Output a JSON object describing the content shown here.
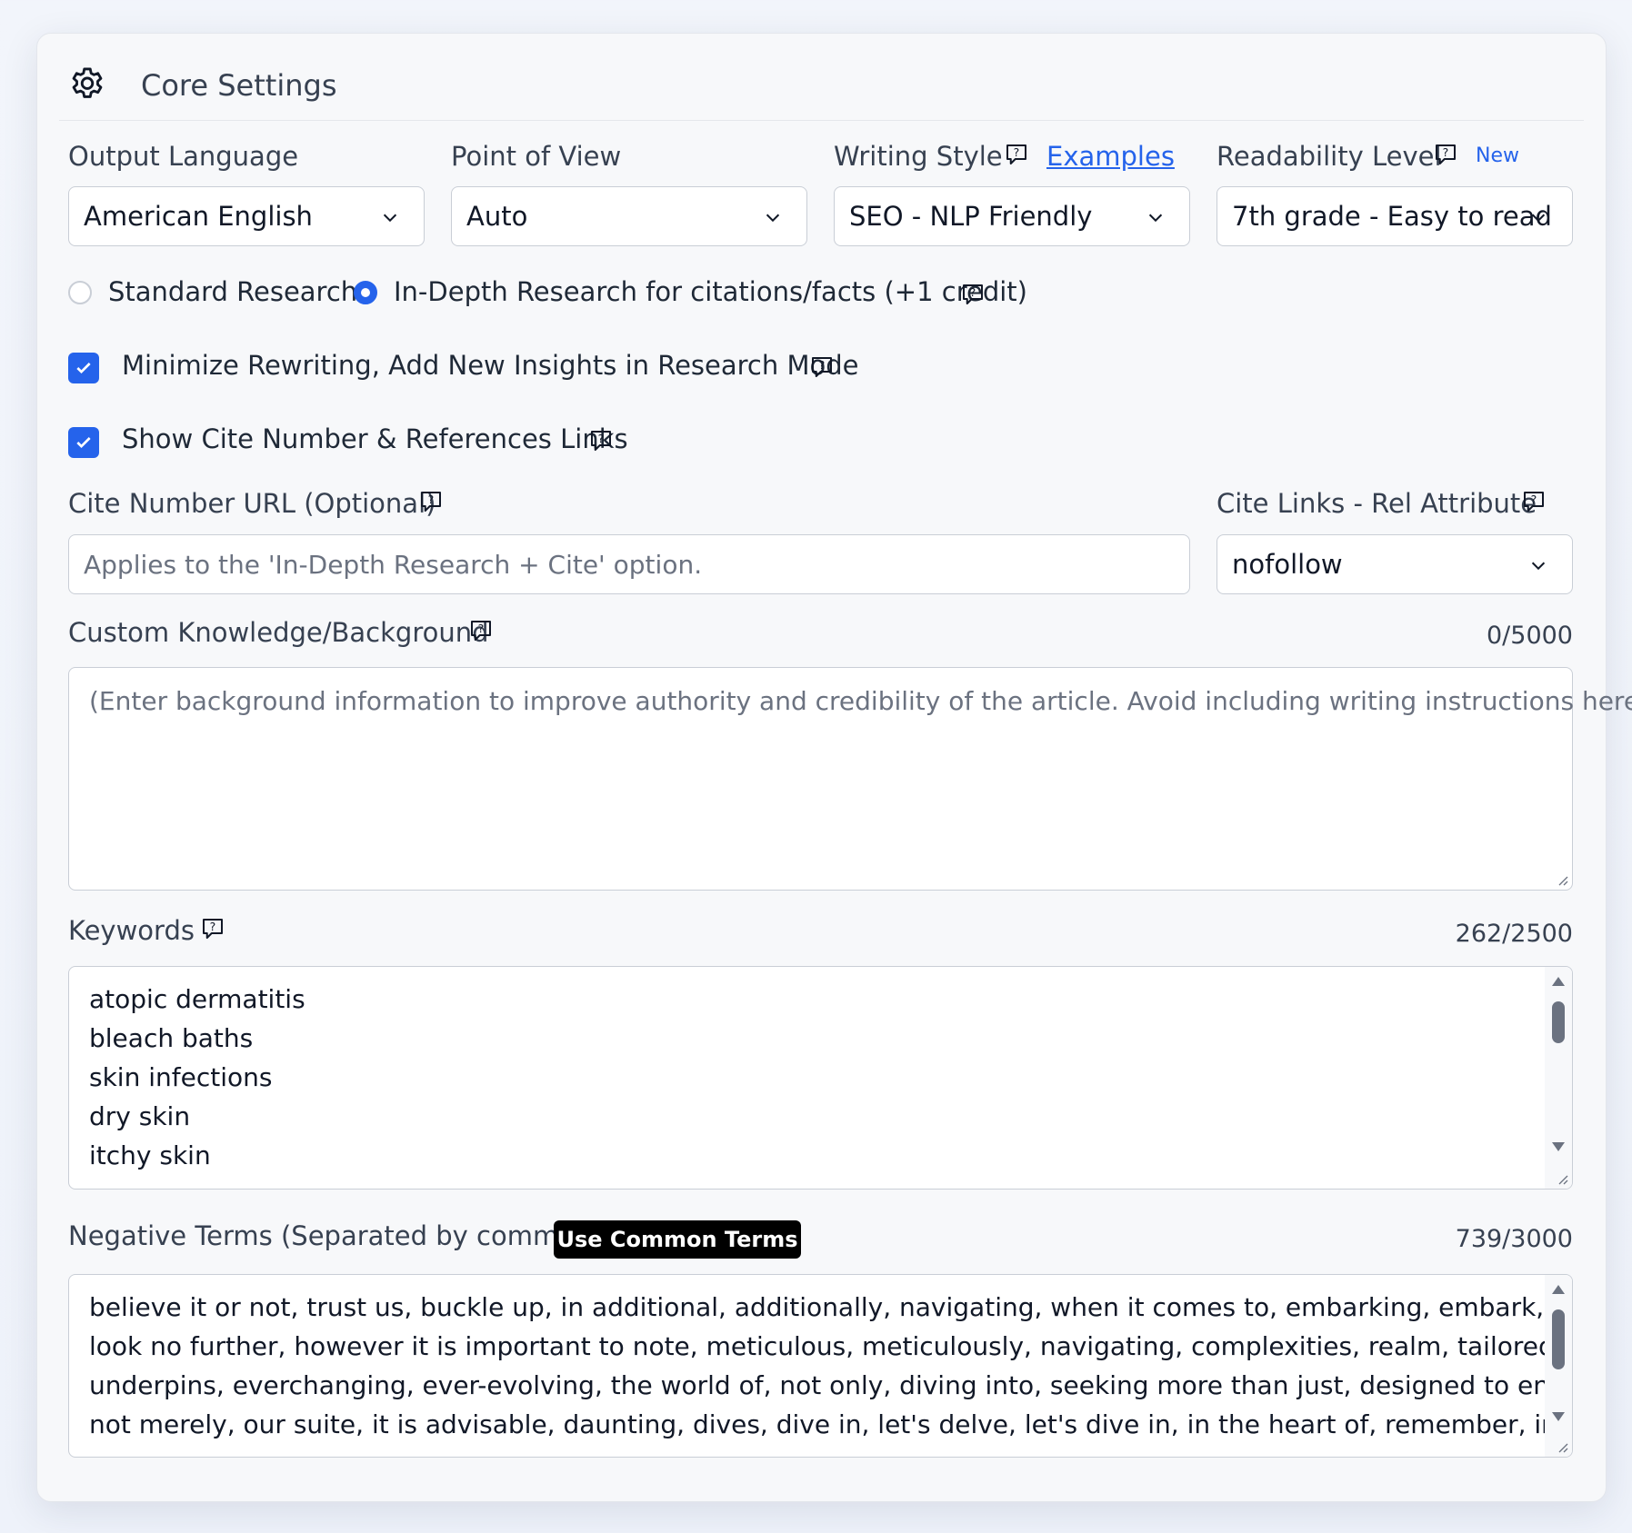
{
  "header": {
    "title": "Core Settings",
    "icon": "gear-icon"
  },
  "output_language": {
    "label": "Output Language",
    "value": "American English"
  },
  "point_of_view": {
    "label": "Point of View",
    "value": "Auto"
  },
  "writing_style": {
    "label": "Writing Style",
    "examples_link": "Examples",
    "value": "SEO - NLP Friendly"
  },
  "readability": {
    "label": "Readability Level",
    "badge": "New",
    "value": "7th grade - Easy to read"
  },
  "research": {
    "standard_label": "Standard Research",
    "indepth_label": "In-Depth Research for citations/facts (+1 credit)",
    "selected": "indepth"
  },
  "checkboxes": {
    "minimize_label": "Minimize Rewriting, Add New Insights in Research Mode",
    "minimize_checked": true,
    "cite_label": "Show Cite Number & References Links",
    "cite_checked": true
  },
  "cite_url": {
    "label": "Cite Number URL (Optional)",
    "placeholder": "Applies to the 'In-Depth Research + Cite' option."
  },
  "cite_rel": {
    "label": "Cite Links - Rel Attribute",
    "value": "nofollow"
  },
  "custom_knowledge": {
    "label": "Custom Knowledge/Background",
    "count": "0/5000",
    "placeholder": "(Enter background information to improve authority and credibility of the article. Avoid including writing instructions here.)"
  },
  "keywords": {
    "label": "Keywords",
    "count": "262/2500",
    "lines": [
      "atopic dermatitis",
      "bleach baths",
      "skin infections",
      "dry skin",
      "itchy skin"
    ]
  },
  "negative_terms": {
    "label": "Negative Terms (Separated by commas)",
    "button": "Use Common Terms",
    "count": "739/3000",
    "lines": [
      "believe it or not, trust us, buckle up, in additional, additionally, navigating, when it comes to, embarking, embark, bespoke,",
      "look no further, however it is important to note, meticulous, meticulously, navigating, complexities, realm, tailored, towards,",
      "underpins, everchanging, ever-evolving, the world of, not only, diving into, seeking more than just, designed to enhance, it's",
      "not merely, our suite, it is advisable, daunting, dives, dive in, let's delve, let's dive in, in the heart of, remember, in an era,"
    ]
  },
  "colors": {
    "accent": "#2563eb",
    "card_bg": "#f7f8fa",
    "border": "#c9ced6"
  }
}
